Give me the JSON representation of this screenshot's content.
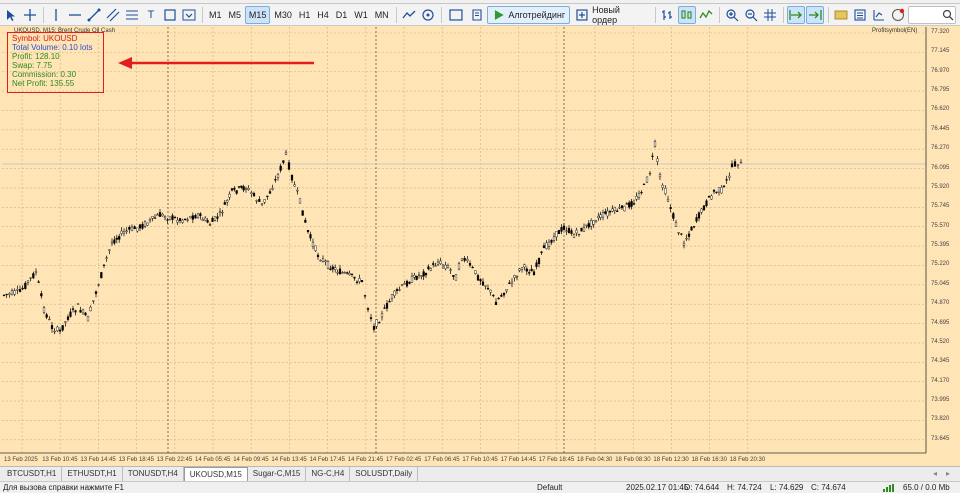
{
  "toolbar": {
    "timeframes": [
      "M1",
      "M5",
      "M15",
      "M30",
      "H1",
      "H4",
      "D1",
      "W1",
      "MN"
    ],
    "active_timeframe": "M15",
    "algo_label": "Алготрейдинг",
    "new_order_label": "Новый ордер"
  },
  "chart": {
    "title": "UKOUSD, M15:  Brent Crude Oil Cash",
    "title_right": "Profitsymbol(EN)",
    "info": {
      "symbol": "Symbol: UKOUSD",
      "volume": "Total Volume: 0.10 lots",
      "profit": "Profit: 128.10",
      "swap": "Swap: 7.75",
      "commission": "Commission: 0.30",
      "net_profit": "Net Profit: 135.55"
    },
    "price_labels": [
      "77.320",
      "77.145",
      "76.970",
      "76.795",
      "76.620",
      "76.445",
      "76.270",
      "76.095",
      "75.920",
      "75.745",
      "75.570",
      "75.395",
      "75.220",
      "75.045",
      "74.870",
      "74.695",
      "74.520",
      "74.345",
      "74.170",
      "73.995",
      "73.820",
      "73.645"
    ],
    "time_labels": [
      "13 Feb 2025",
      "13 Feb 10:45",
      "13 Feb 14:45",
      "13 Feb 18:45",
      "13 Feb 22:45",
      "14 Feb 05:45",
      "14 Feb 09:45",
      "14 Feb 13:45",
      "14 Feb 17:45",
      "14 Feb 21:45",
      "17 Feb 02:45",
      "17 Feb 06:45",
      "17 Feb 10:45",
      "17 Feb 14:45",
      "17 Feb 18:45",
      "18 Feb 04:30",
      "18 Feb 08:30",
      "18 Feb 12:30",
      "18 Feb 16:30",
      "18 Feb 20:30"
    ],
    "colors": {
      "background": "#ffe4b5",
      "candle": "#000000",
      "arrow": "#e31c1c",
      "info_border": "#e31c1c"
    }
  },
  "tabs": [
    "BTCUSDT,H1",
    "ETHUSDT,H1",
    "TONUSDT,H4",
    "UKOUSD,M15",
    "Sugar-C,M15",
    "NG-C,H4",
    "SOLUSDT,Daily"
  ],
  "active_tab": "UKOUSD,M15",
  "status": {
    "help": "Для вызова справки нажмите F1",
    "profile": "Default",
    "datetime": "2025.02.17 01:45",
    "open": "O: 74.644",
    "high": "H: 74.724",
    "low": "L: 74.629",
    "close": "C: 74.674",
    "traffic": "65.0 / 0.0 Mb"
  }
}
